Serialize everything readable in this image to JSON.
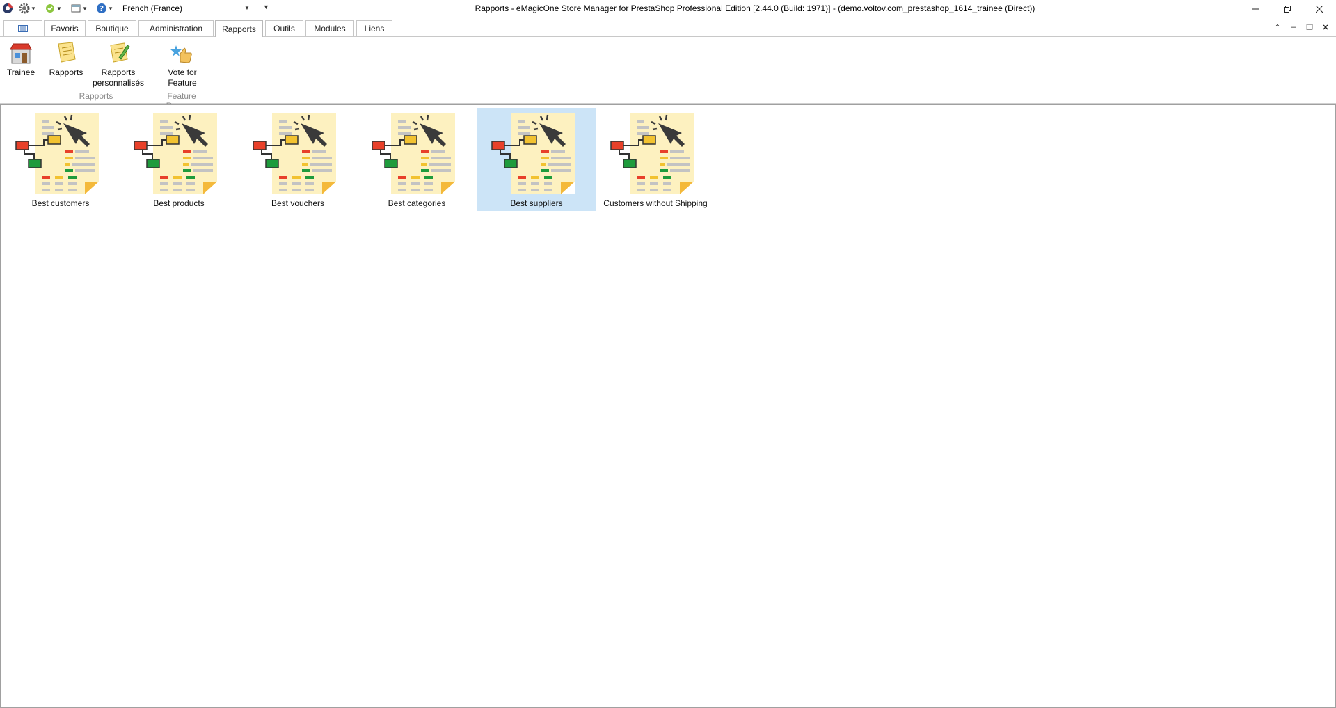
{
  "window": {
    "title": "Rapports - eMagicOne Store Manager for PrestaShop Professional Edition [2.44.0 (Build: 1971)] - (demo.voltov.com_prestashop_1614_trainee (Direct))"
  },
  "quick_access": {
    "language": "French (France)"
  },
  "tabs": [
    {
      "label": "Favoris"
    },
    {
      "label": "Boutique"
    },
    {
      "label": "Administration"
    },
    {
      "label": "Rapports",
      "active": true
    },
    {
      "label": "Outils"
    },
    {
      "label": "Modules"
    },
    {
      "label": "Liens"
    }
  ],
  "ribbon": {
    "trainee": "Trainee",
    "rapports": "Rapports",
    "rapports_perso_1": "Rapports",
    "rapports_perso_2": "personnalisés",
    "vote_1": "Vote for",
    "vote_2": "Feature",
    "group_rapports": "Rapports",
    "group_feature": "Feature Request"
  },
  "reports": [
    {
      "label": "Best customers"
    },
    {
      "label": "Best products"
    },
    {
      "label": "Best vouchers"
    },
    {
      "label": "Best categories"
    },
    {
      "label": "Best suppliers",
      "selected": true
    },
    {
      "label": "Customers without Shipping"
    }
  ],
  "colors": {
    "selection": "#cce4f7",
    "doc_fill": "#fdf1c0",
    "accent_red": "#e8402a",
    "accent_yellow": "#f2c230",
    "accent_green": "#1e9b3c"
  }
}
